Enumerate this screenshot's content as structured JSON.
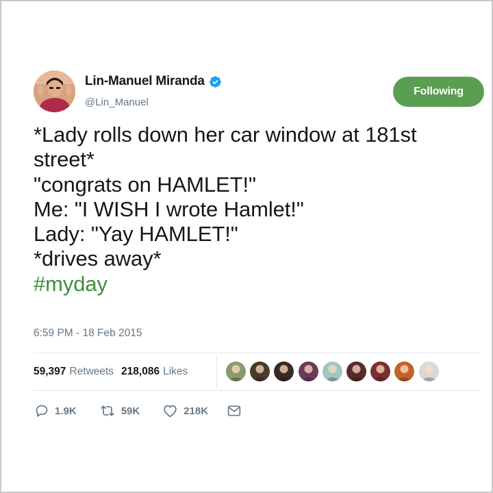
{
  "author": {
    "display_name": "Lin-Manuel Miranda",
    "handle": "@Lin_Manuel",
    "verified": true,
    "avatar_icon": "avatar-photo"
  },
  "follow_button": {
    "label": "Following",
    "color": "#5a9e52"
  },
  "tweet": {
    "lines": [
      "*Lady rolls down her car window at 181st",
      "street*",
      "\"congrats on HAMLET!\"",
      "Me: \"I WISH I wrote Hamlet!\"",
      "Lady: \"Yay HAMLET!\"",
      "*drives away*"
    ],
    "hashtag": "#myday",
    "hashtag_color": "#3f8f3a",
    "timestamp": "6:59 PM - 18 Feb 2015"
  },
  "stats": {
    "retweets_count": "59,397",
    "retweets_label": "Retweets",
    "likes_count": "218,086",
    "likes_label": "Likes"
  },
  "likers": [
    {
      "icon": "liker-avatar-1",
      "color": "#8a9a6b"
    },
    {
      "icon": "liker-avatar-2",
      "color": "#4a3a2a"
    },
    {
      "icon": "liker-avatar-3",
      "color": "#3a2a24"
    },
    {
      "icon": "liker-avatar-4",
      "color": "#6b3a5a"
    },
    {
      "icon": "liker-avatar-5",
      "color": "#9ec7c2"
    },
    {
      "icon": "liker-avatar-6",
      "color": "#5a2a2a"
    },
    {
      "icon": "liker-avatar-7",
      "color": "#7a3030"
    },
    {
      "icon": "liker-avatar-8",
      "color": "#c0622a"
    },
    {
      "icon": "liker-avatar-9",
      "color": "#d8d8d8"
    }
  ],
  "actions": {
    "reply_count": "1.9K",
    "retweet_count": "59K",
    "like_count": "218K",
    "reply_icon": "reply-icon",
    "retweet_icon": "retweet-icon",
    "like_icon": "heart-icon",
    "dm_icon": "envelope-icon"
  }
}
